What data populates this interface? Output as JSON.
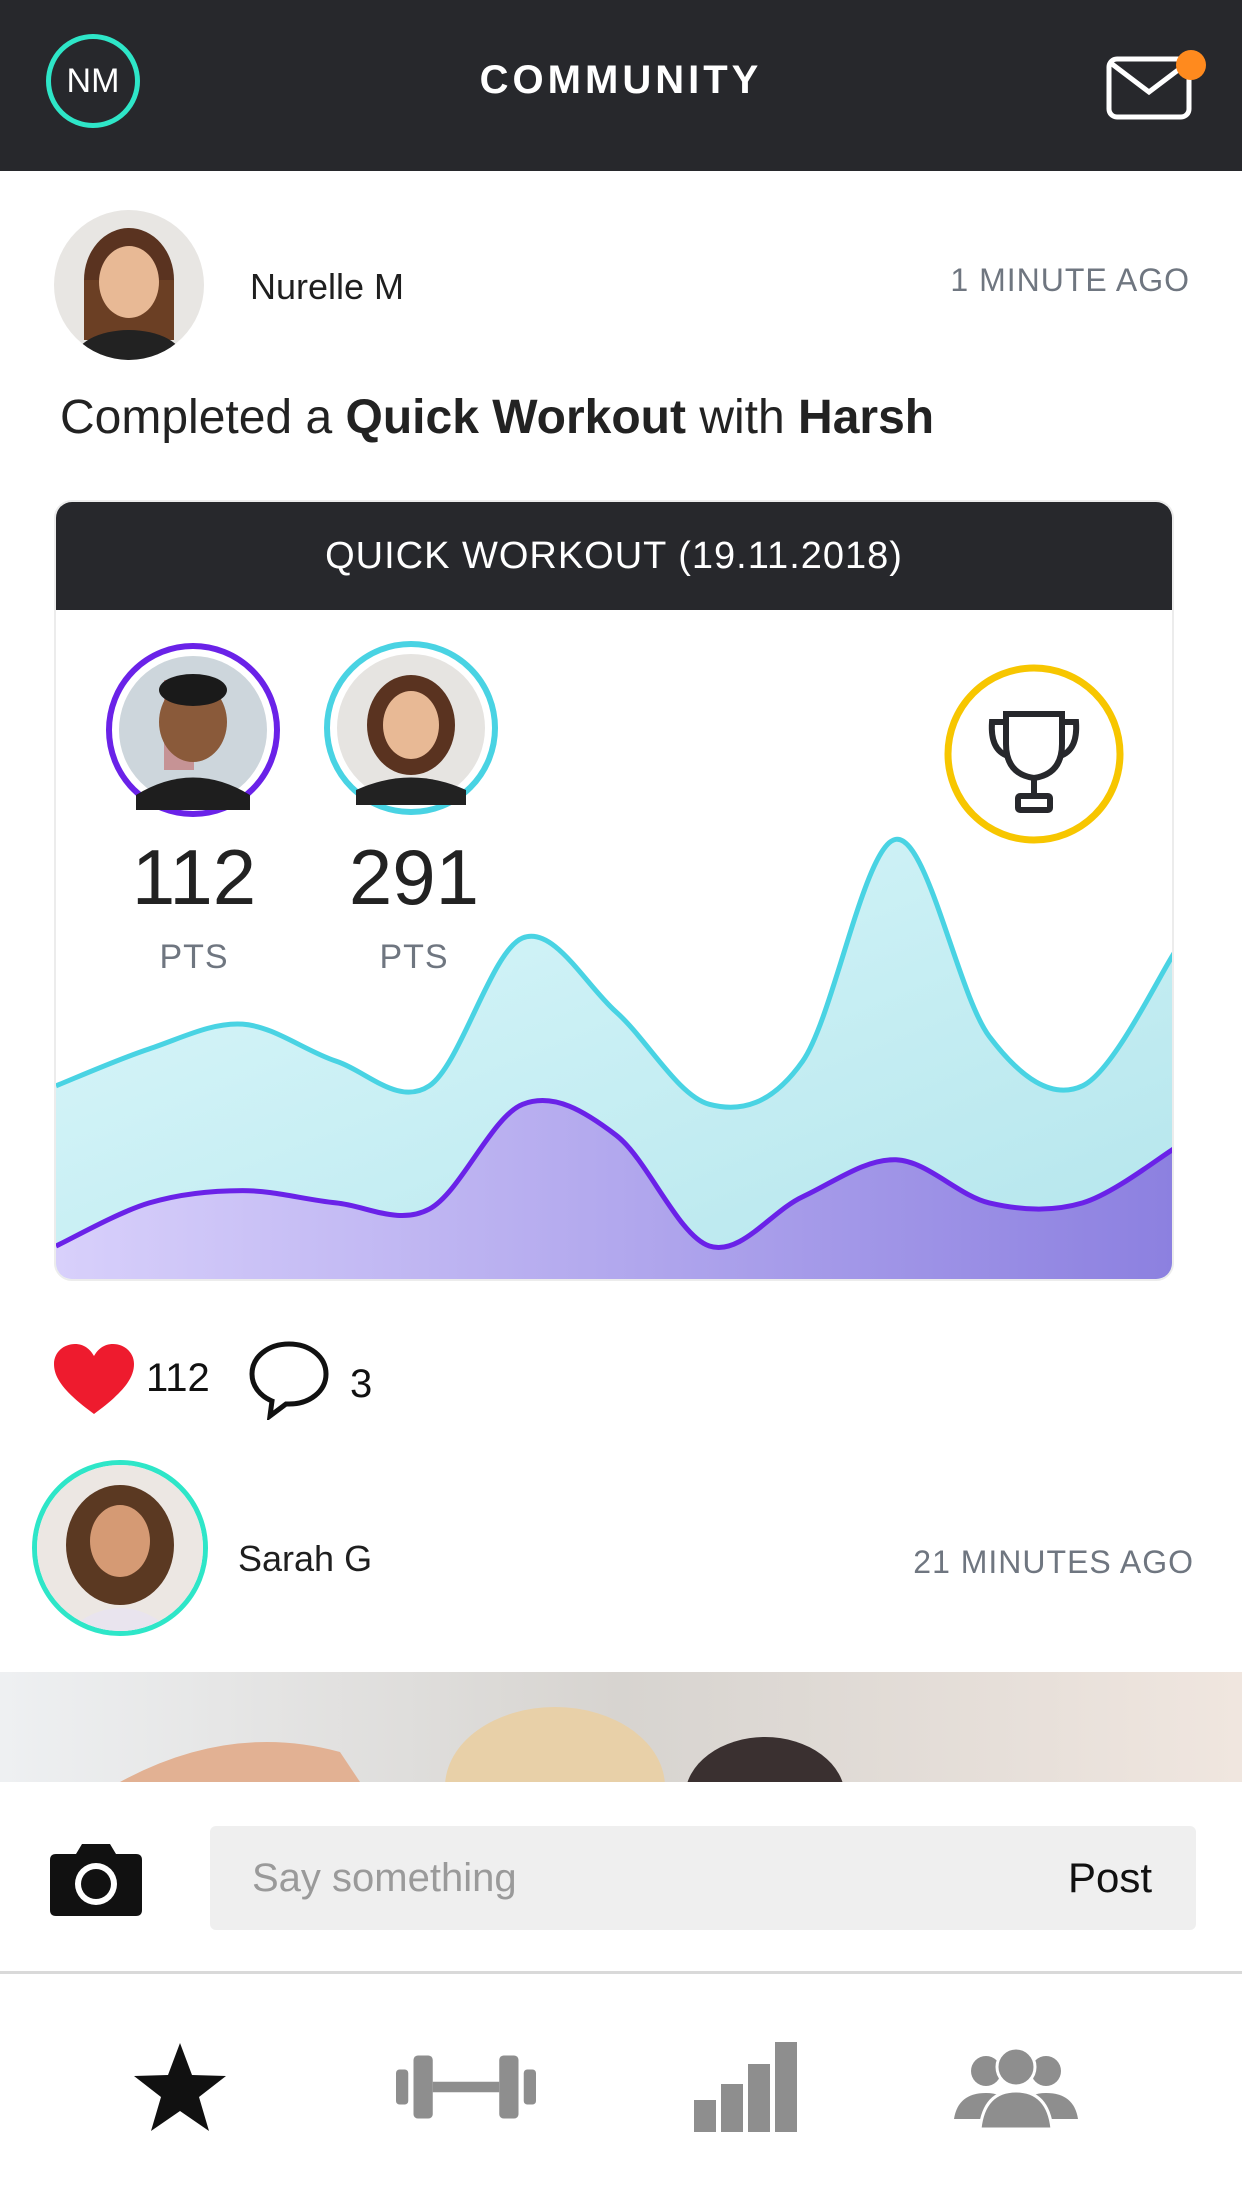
{
  "header": {
    "user_initials": "NM",
    "title": "COMMUNITY",
    "mail_icon": "mail-icon",
    "notification_color": "#ff8a1e"
  },
  "post1": {
    "user_name": "Nurelle M",
    "time": "1 MINUTE AGO",
    "text_prefix": "Completed a",
    "workout_name": "Quick Workout",
    "text_with": "with",
    "partner": "Harsh",
    "card": {
      "title": "QUICK WORKOUT (19.11.2018)",
      "players": [
        {
          "points": "112",
          "label": "PTS",
          "ring_color": "#6a22e8"
        },
        {
          "points": "291",
          "label": "PTS",
          "ring_color": "#49d3e3"
        }
      ],
      "trophy_color": "#f7c600"
    },
    "likes": "112",
    "comments": "3"
  },
  "post2": {
    "user_name": "Sarah G",
    "time": "21 MINUTES AGO"
  },
  "composer": {
    "placeholder": "Say something",
    "post_label": "Post"
  },
  "tabs": [
    "star-icon",
    "dumbbell-icon",
    "stats-icon",
    "community-icon"
  ],
  "chart_data": {
    "type": "area",
    "series": [
      {
        "values": [
          3.2,
          3.8,
          4.2,
          3.6,
          3.2,
          5.6,
          4.4,
          2.9,
          3.6,
          7.2,
          4.0,
          3.2,
          5.4
        ]
      },
      {
        "values": [
          0.6,
          1.3,
          1.5,
          1.3,
          1.2,
          2.9,
          2.4,
          0.6,
          1.4,
          2.0,
          1.3,
          1.3,
          2.2
        ]
      }
    ],
    "colors": [
      "#49d3e3",
      "#6a22e8"
    ]
  }
}
